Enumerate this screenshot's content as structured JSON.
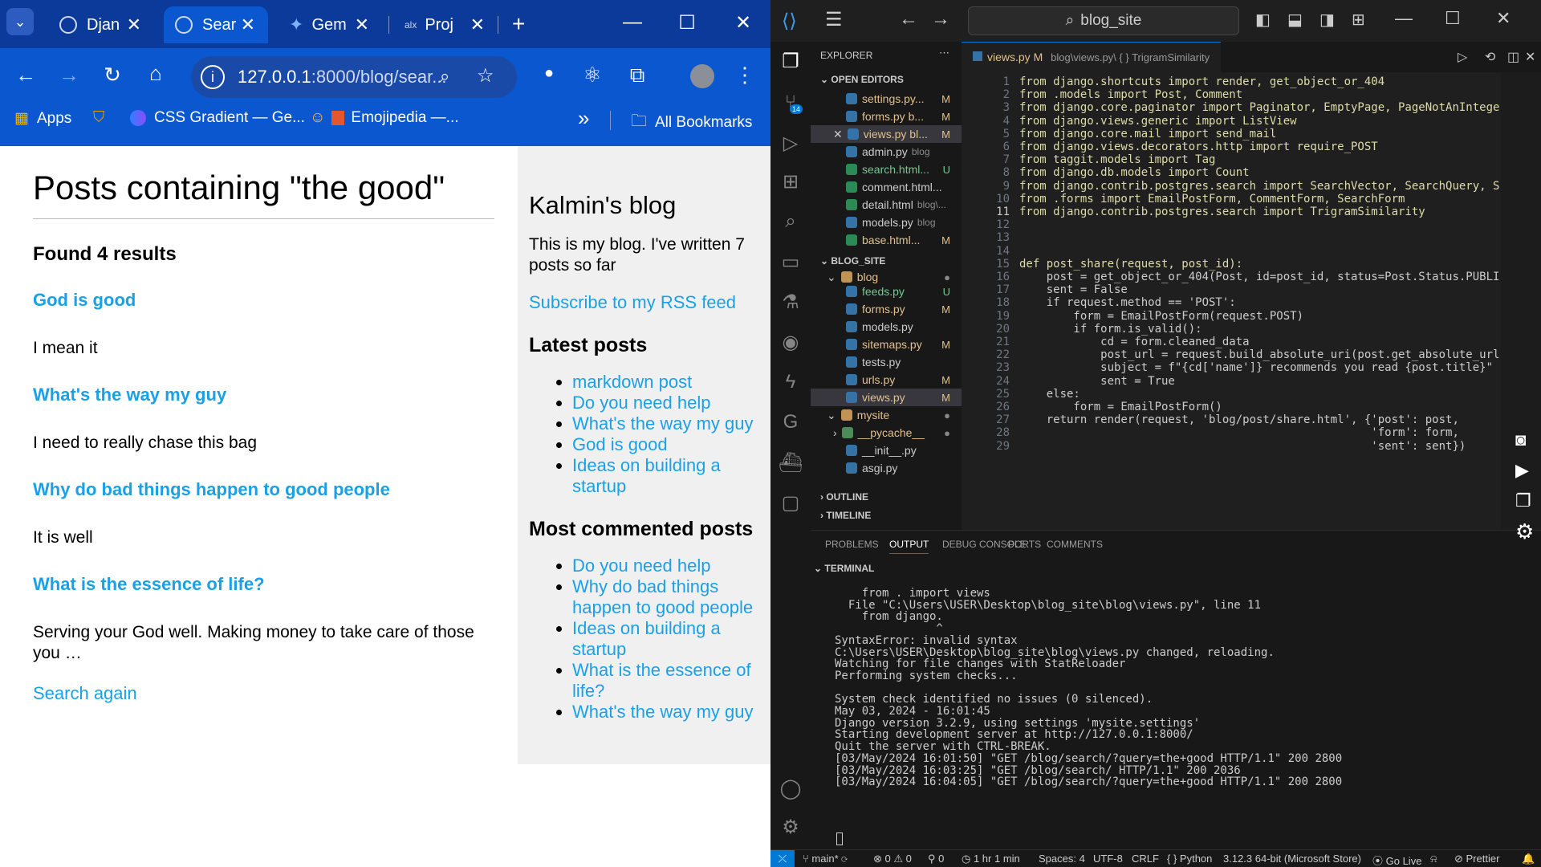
{
  "browser": {
    "tabs": [
      {
        "label": "Djan"
      },
      {
        "label": "Sear"
      },
      {
        "label": "Gem"
      },
      {
        "label": "Proj"
      }
    ],
    "url_host": "127.0.0.1",
    "url_rest": ":8000/blog/sear...",
    "bookmarks": {
      "apps": "Apps",
      "css_gradient": "CSS Gradient — Ge...",
      "emojipedia": "Emojipedia —...",
      "all_bookmarks": "All Bookmarks",
      "overflow": "»"
    }
  },
  "page": {
    "heading": "Posts containing \"the good\"",
    "found": "Found 4 results",
    "results": [
      {
        "title": "God is good",
        "body": "I mean it"
      },
      {
        "title": "What's the way my guy",
        "body": "I need to really chase this bag"
      },
      {
        "title": "Why do bad things happen to good people",
        "body": "It is well"
      },
      {
        "title": "What is the essence of life?",
        "body": "Serving your God well. Making money to take care of those you …"
      }
    ],
    "search_again": "Search again",
    "sidebar": {
      "title": "Kalmin's blog",
      "intro": "This is my blog. I've written 7 posts so far",
      "rss": "Subscribe to my RSS feed",
      "latest_heading": "Latest posts",
      "latest": [
        "markdown post",
        "Do you need help",
        "What's the way my guy",
        "God is good",
        "Ideas on building a startup"
      ],
      "commented_heading": "Most commented posts",
      "commented": [
        "Do you need help",
        "Why do bad things happen to good people",
        "Ideas on building a startup",
        "What is the essence of life?",
        "What's the way my guy"
      ]
    }
  },
  "vscode": {
    "search": "blog_site",
    "explorer_title": "EXPLORER",
    "open_editors_label": "OPEN EDITORS",
    "open_editors": [
      {
        "name": "settings.py...",
        "status": "M"
      },
      {
        "name": "forms.py b...",
        "status": "M"
      },
      {
        "name": "views.py bl...",
        "status": "M"
      },
      {
        "name": "admin.py",
        "path": "blog",
        "status": ""
      },
      {
        "name": "search.html...",
        "status": "U"
      },
      {
        "name": "comment.html...",
        "status": ""
      },
      {
        "name": "detail.html",
        "path": "blog\\...",
        "status": ""
      },
      {
        "name": "models.py",
        "path": "blog",
        "status": ""
      },
      {
        "name": "base.html...",
        "status": "M"
      }
    ],
    "project_label": "BLOG_SITE",
    "tree": [
      {
        "name": "blog",
        "status": ""
      },
      {
        "name": "feeds.py",
        "status": "U"
      },
      {
        "name": "forms.py",
        "status": "M"
      },
      {
        "name": "models.py",
        "status": ""
      },
      {
        "name": "sitemaps.py",
        "status": "M"
      },
      {
        "name": "tests.py",
        "status": ""
      },
      {
        "name": "urls.py",
        "status": "M"
      },
      {
        "name": "views.py",
        "status": "M"
      },
      {
        "name": "mysite",
        "status": ""
      },
      {
        "name": "__pycache__",
        "status": ""
      },
      {
        "name": "__init__.py",
        "status": ""
      },
      {
        "name": "asgi.py",
        "status": ""
      }
    ],
    "outline_label": "OUTLINE",
    "timeline_label": "TIMELINE",
    "badge": "14",
    "editor_tab": "views.py",
    "editor_tab_status": "M",
    "breadcrumb": "blog\\views.py\\ { } TrigramSimilarity",
    "code_lines": [
      {
        "n": "1",
        "t": "from django.shortcuts import render, get_object_or_404"
      },
      {
        "n": "2",
        "t": "from .models import Post, Comment"
      },
      {
        "n": "3",
        "t": "from django.core.paginator import Paginator, EmptyPage, PageNotAnIntege"
      },
      {
        "n": "4",
        "t": "from django.views.generic import ListView"
      },
      {
        "n": "5",
        "t": "from django.core.mail import send_mail"
      },
      {
        "n": "6",
        "t": "from django.views.decorators.http import require_POST"
      },
      {
        "n": "7",
        "t": "from taggit.models import Tag"
      },
      {
        "n": "8",
        "t": "from django.db.models import Count"
      },
      {
        "n": "9",
        "t": "from django.contrib.postgres.search import SearchVector, SearchQuery, S"
      },
      {
        "n": "10",
        "t": "from .forms import EmailPostForm, CommentForm, SearchForm"
      },
      {
        "n": "11",
        "t": "from django.contrib.postgres.search import TrigramSimilarity"
      },
      {
        "n": "12",
        "t": ""
      },
      {
        "n": "13",
        "t": ""
      },
      {
        "n": "14",
        "t": ""
      },
      {
        "n": "15",
        "t": "def post_share(request, post_id):"
      },
      {
        "n": "16",
        "t": "    post = get_object_or_404(Post, id=post_id, status=Post.Status.PUBLI"
      },
      {
        "n": "17",
        "t": "    sent = False"
      },
      {
        "n": "18",
        "t": "    if request.method == 'POST':"
      },
      {
        "n": "19",
        "t": "        form = EmailPostForm(request.POST)"
      },
      {
        "n": "20",
        "t": "        if form.is_valid():"
      },
      {
        "n": "21",
        "t": "            cd = form.cleaned_data"
      },
      {
        "n": "22",
        "t": "            post_url = request.build_absolute_uri(post.get_absolute_url"
      },
      {
        "n": "23",
        "t": "            subject = f\"{cd['name']} recommends you read {post.title}\""
      },
      {
        "n": "24",
        "t": "            sent = True"
      },
      {
        "n": "25",
        "t": "    else:"
      },
      {
        "n": "26",
        "t": "        form = EmailPostForm()"
      },
      {
        "n": "27",
        "t": "    return render(request, 'blog/post/share.html', {'post': post,"
      },
      {
        "n": "28",
        "t": "                                                    'form': form,"
      },
      {
        "n": "29",
        "t": "                                                    'sent': sent})"
      }
    ],
    "panel_tabs": [
      "PROBLEMS",
      "OUTPUT",
      "DEBUG CONSOLE",
      "PORTS",
      "COMMENTS"
    ],
    "terminal_label": "TERMINAL",
    "terminal_lines": [
      "    from . import views",
      "  File \"C:\\Users\\USER\\Desktop\\blog_site\\blog\\views.py\", line 11",
      "    from django.",
      "               ^",
      "SyntaxError: invalid syntax",
      "C:\\Users\\USER\\Desktop\\blog_site\\blog\\views.py changed, reloading.",
      "Watching for file changes with StatReloader",
      "Performing system checks...",
      "",
      "System check identified no issues (0 silenced).",
      "May 03, 2024 - 16:01:45",
      "Django version 3.2.9, using settings 'mysite.settings'",
      "Starting development server at http://127.0.0.1:8000/",
      "Quit the server with CTRL-BREAK.",
      "[03/May/2024 16:01:50] \"GET /blog/search/?query=the+good HTTP/1.1\" 200 2800",
      "[03/May/2024 16:03:25] \"GET /blog/search/ HTTP/1.1\" 200 2036",
      "[03/May/2024 16:04:05] \"GET /blog/search/?query=the+good HTTP/1.1\" 200 2800"
    ],
    "status": {
      "branch": "main*",
      "problems": "⊗ 0 ⚠ 0",
      "ports": "0",
      "time": "1 hr 1 min",
      "spaces": "Spaces: 4",
      "encoding": "UTF-8",
      "eol": "CRLF",
      "lang": "{ } Python",
      "interpreter": "3.12.3 64-bit (Microsoft Store)",
      "golive": "Go Live",
      "prettier": "Prettier"
    }
  }
}
